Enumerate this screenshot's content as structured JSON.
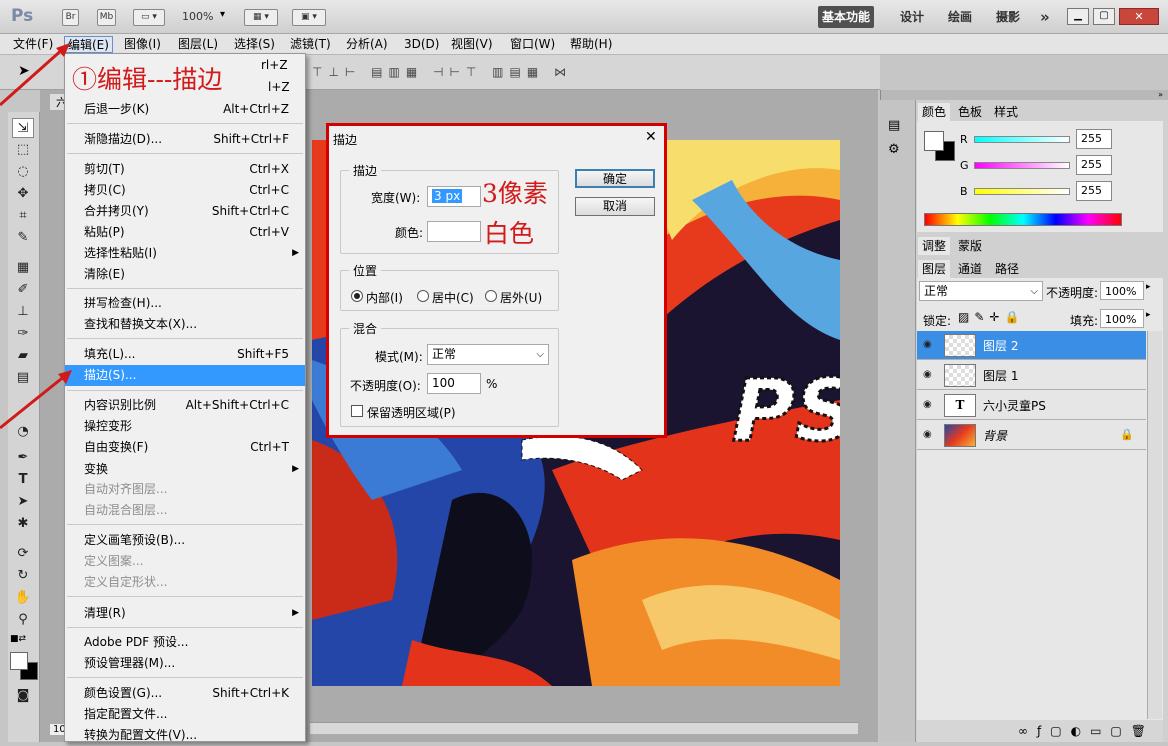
{
  "app": {
    "logo": "Ps",
    "bridge_btn": "Br",
    "minibridge_btn": "Mb",
    "zoom_value": "100%",
    "workspaces": [
      "基本功能",
      "设计",
      "绘画",
      "摄影"
    ],
    "more": "»"
  },
  "menubar": [
    "文件(F)",
    "编辑(E)",
    "图像(I)",
    "图层(L)",
    "选择(S)",
    "滤镜(T)",
    "分析(A)",
    "3D(D)",
    "视图(V)",
    "窗口(W)",
    "帮助(H)"
  ],
  "doc_tab_partial": "六",
  "status_zoom_partial": "10",
  "edit_menu": {
    "hidden_shortcut_1": "rl+Z",
    "hidden_shortcut_2": "l+Z",
    "items": [
      {
        "label": "后退一步(K)",
        "shortcut": "Alt+Ctrl+Z"
      },
      {
        "label": "渐隐描边(D)...",
        "shortcut": "Shift+Ctrl+F"
      },
      {
        "label": "剪切(T)",
        "shortcut": "Ctrl+X"
      },
      {
        "label": "拷贝(C)",
        "shortcut": "Ctrl+C"
      },
      {
        "label": "合并拷贝(Y)",
        "shortcut": "Shift+Ctrl+C"
      },
      {
        "label": "粘贴(P)",
        "shortcut": "Ctrl+V"
      },
      {
        "label": "选择性粘贴(I)",
        "shortcut": ""
      },
      {
        "label": "清除(E)",
        "shortcut": ""
      },
      {
        "label": "拼写检查(H)...",
        "shortcut": ""
      },
      {
        "label": "查找和替换文本(X)...",
        "shortcut": ""
      },
      {
        "label": "填充(L)...",
        "shortcut": "Shift+F5"
      },
      {
        "label": "描边(S)...",
        "shortcut": ""
      },
      {
        "label": "内容识别比例",
        "shortcut": "Alt+Shift+Ctrl+C"
      },
      {
        "label": "操控变形",
        "shortcut": ""
      },
      {
        "label": "自由变换(F)",
        "shortcut": "Ctrl+T"
      },
      {
        "label": "变换",
        "shortcut": ""
      },
      {
        "label": "自动对齐图层...",
        "shortcut": ""
      },
      {
        "label": "自动混合图层...",
        "shortcut": ""
      },
      {
        "label": "定义画笔预设(B)...",
        "shortcut": ""
      },
      {
        "label": "定义图案...",
        "shortcut": ""
      },
      {
        "label": "定义自定形状...",
        "shortcut": ""
      },
      {
        "label": "清理(R)",
        "shortcut": ""
      },
      {
        "label": "Adobe PDF 预设...",
        "shortcut": ""
      },
      {
        "label": "预设管理器(M)...",
        "shortcut": ""
      },
      {
        "label": "颜色设置(G)...",
        "shortcut": "Shift+Ctrl+K"
      },
      {
        "label": "指定配置文件...",
        "shortcut": ""
      },
      {
        "label": "转换为配置文件(V)...",
        "shortcut": ""
      }
    ]
  },
  "annotations": {
    "step1": "①编辑---描边",
    "width_note": "3像素",
    "color_note": "白色"
  },
  "stroke_dialog": {
    "title": "描边",
    "close": "✕",
    "group_stroke": "描边",
    "width_label": "宽度(W):",
    "width_value": "3 px",
    "color_label": "颜色:",
    "group_location": "位置",
    "loc_inside": "内部(I)",
    "loc_center": "居中(C)",
    "loc_outside": "居外(U)",
    "group_blend": "混合",
    "mode_label": "模式(M):",
    "mode_value": "正常",
    "opacity_label": "不透明度(O):",
    "opacity_value": "100",
    "opacity_unit": "%",
    "preserve_label": "保留透明区域(P)",
    "ok": "确定",
    "cancel": "取消"
  },
  "canvas_text": "PS",
  "color_panel": {
    "tabs": [
      "颜色",
      "色板",
      "样式"
    ],
    "r_label": "R",
    "g_label": "G",
    "b_label": "B",
    "r": "255",
    "g": "255",
    "b": "255"
  },
  "adjust_panel": {
    "tabs": [
      "调整",
      "蒙版"
    ]
  },
  "layers_panel": {
    "tabs": [
      "图层",
      "通道",
      "路径"
    ],
    "blend_mode": "正常",
    "opacity_label": "不透明度:",
    "opacity": "100%",
    "lock_label": "锁定:",
    "fill_label": "填充:",
    "fill": "100%",
    "layers": [
      {
        "name": "图层 2",
        "selected": true
      },
      {
        "name": "图层 1",
        "selected": false
      },
      {
        "name": "六小灵童PS",
        "selected": false,
        "thumb": "T"
      },
      {
        "name": "背景",
        "selected": false
      }
    ]
  }
}
